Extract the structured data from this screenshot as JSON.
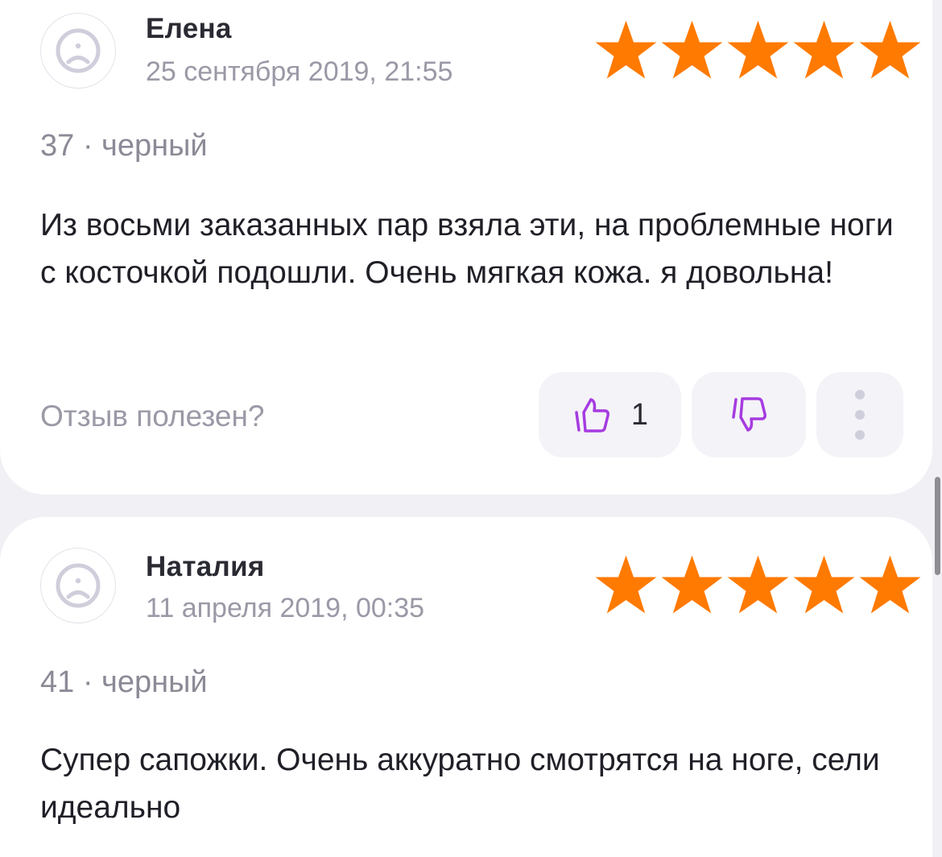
{
  "colors": {
    "star": "#ff7a00",
    "accent": "#a63be0",
    "muted_text": "#9a99a6",
    "card_bg": "#ffffff",
    "page_bg": "#f1f0f4"
  },
  "reviews": [
    {
      "author": "Елена",
      "date": "25 сентября 2019, 21:55",
      "rating": 5,
      "variant": "37 · черный",
      "text": "Из восьми заказанных пар взяла эти, на проблемные ноги с косточкой подошли. Очень мягкая кожа. я довольна!",
      "helpful_label": "Отзыв полезен?",
      "likes": "1",
      "avatar_icon": "sad-face-icon",
      "like_icon": "thumbs-up-icon",
      "dislike_icon": "thumbs-down-icon",
      "more_icon": "vertical-dots-icon"
    },
    {
      "author": "Наталия",
      "date": "11 апреля 2019, 00:35",
      "rating": 5,
      "variant": "41 · черный",
      "text": "Супер сапожки. Очень аккуратно смотрятся на ноге, сели идеально",
      "avatar_icon": "sad-face-icon"
    }
  ]
}
